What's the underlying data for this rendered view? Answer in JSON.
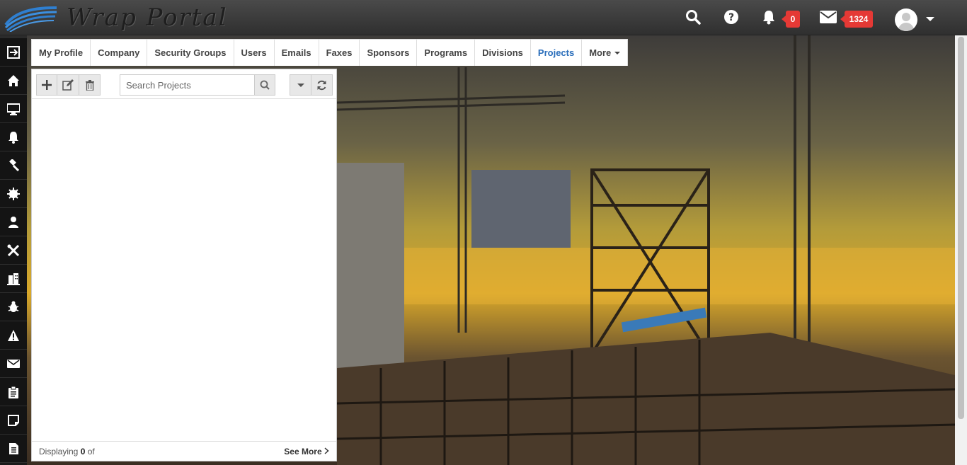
{
  "header": {
    "logo_text": "Wrap Portal",
    "notifications_count": "0",
    "messages_count": "1324"
  },
  "tabs": [
    {
      "label": "My Profile"
    },
    {
      "label": "Company"
    },
    {
      "label": "Security Groups"
    },
    {
      "label": "Users"
    },
    {
      "label": "Emails"
    },
    {
      "label": "Faxes"
    },
    {
      "label": "Sponsors"
    },
    {
      "label": "Programs"
    },
    {
      "label": "Divisions"
    },
    {
      "label": "Projects",
      "active": true
    },
    {
      "label": "More"
    }
  ],
  "panel": {
    "search_placeholder": "Search Projects",
    "footer_prefix": "Displaying",
    "footer_count": "0",
    "footer_suffix": "of",
    "see_more": "See More"
  },
  "sidebar_icons": [
    "sign-out-icon",
    "home-icon",
    "desktop-icon",
    "bell-icon",
    "gavel-icon",
    "certificate-icon",
    "user-icon",
    "tools-icon",
    "building-icon",
    "bug-icon",
    "warning-icon",
    "envelope-icon",
    "clipboard-icon",
    "sticky-note-icon",
    "document-icon"
  ],
  "colors": {
    "accent": "#2a6ebb",
    "badge": "#e53935",
    "topbar": "#3a3a3a"
  }
}
